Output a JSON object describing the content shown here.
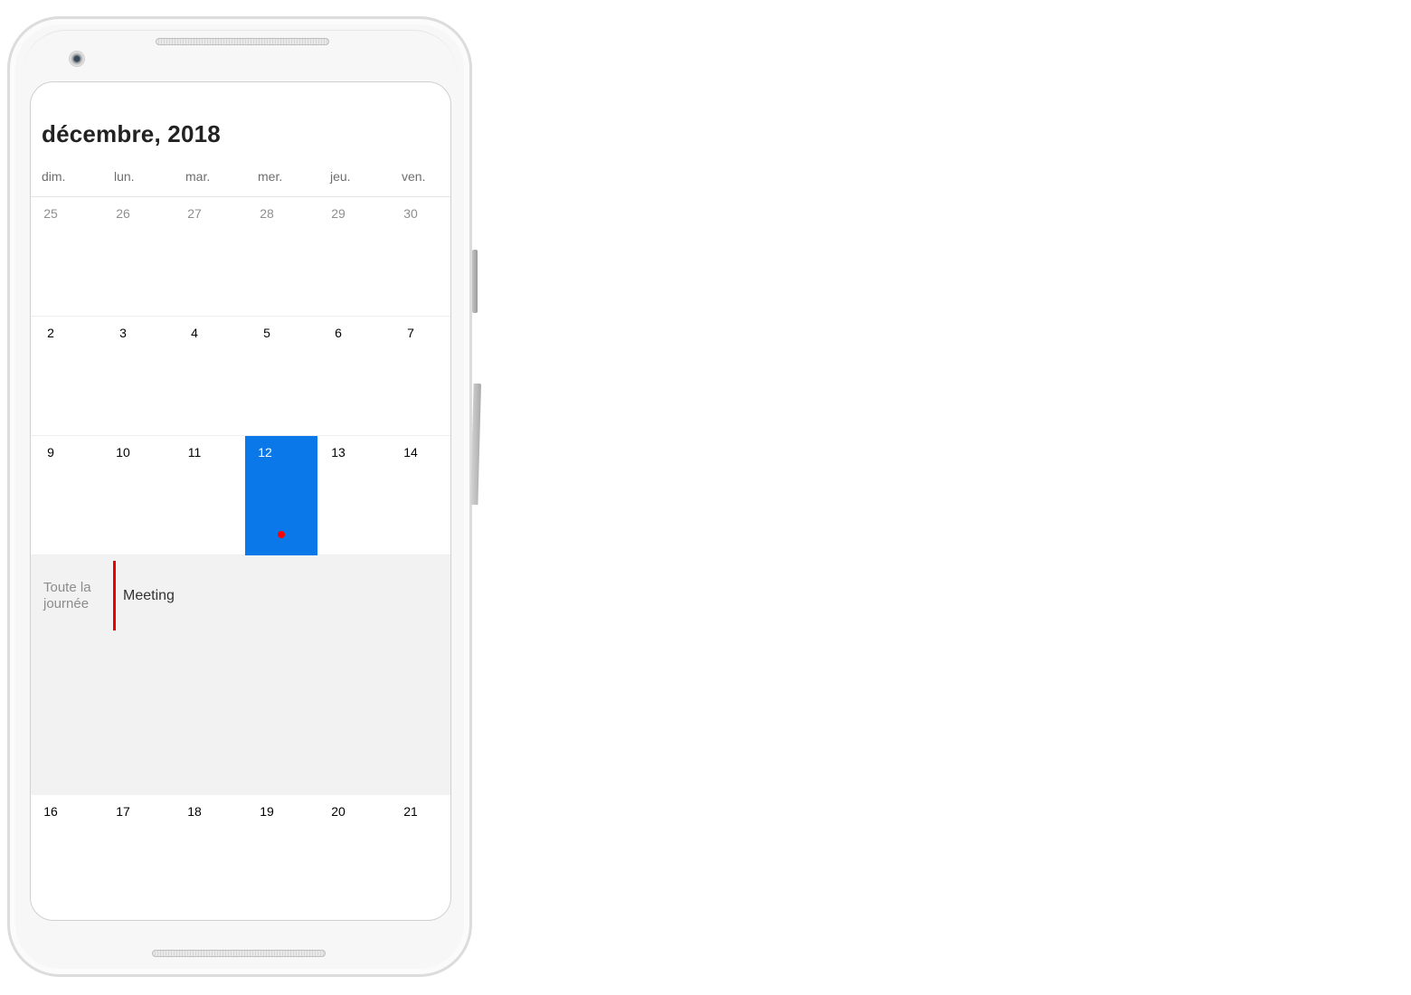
{
  "calendar": {
    "month_title": "décembre, 2018",
    "weekdays": [
      "dim.",
      "lun.",
      "mar.",
      "mer.",
      "jeu.",
      "ven."
    ],
    "weeks": [
      [
        "25",
        "26",
        "27",
        "28",
        "29",
        "30"
      ],
      [
        "2",
        "3",
        "4",
        "5",
        "6",
        "7"
      ],
      [
        "9",
        "10",
        "11",
        "12",
        "13",
        "14"
      ],
      [
        "16",
        "17",
        "18",
        "19",
        "20",
        "21"
      ]
    ],
    "selected_day": "12",
    "accent_color": "#0a78e8"
  },
  "agenda": {
    "all_day_label": "Toute la journée",
    "events": [
      {
        "title": "Meeting",
        "color": "#ee0000"
      }
    ]
  }
}
